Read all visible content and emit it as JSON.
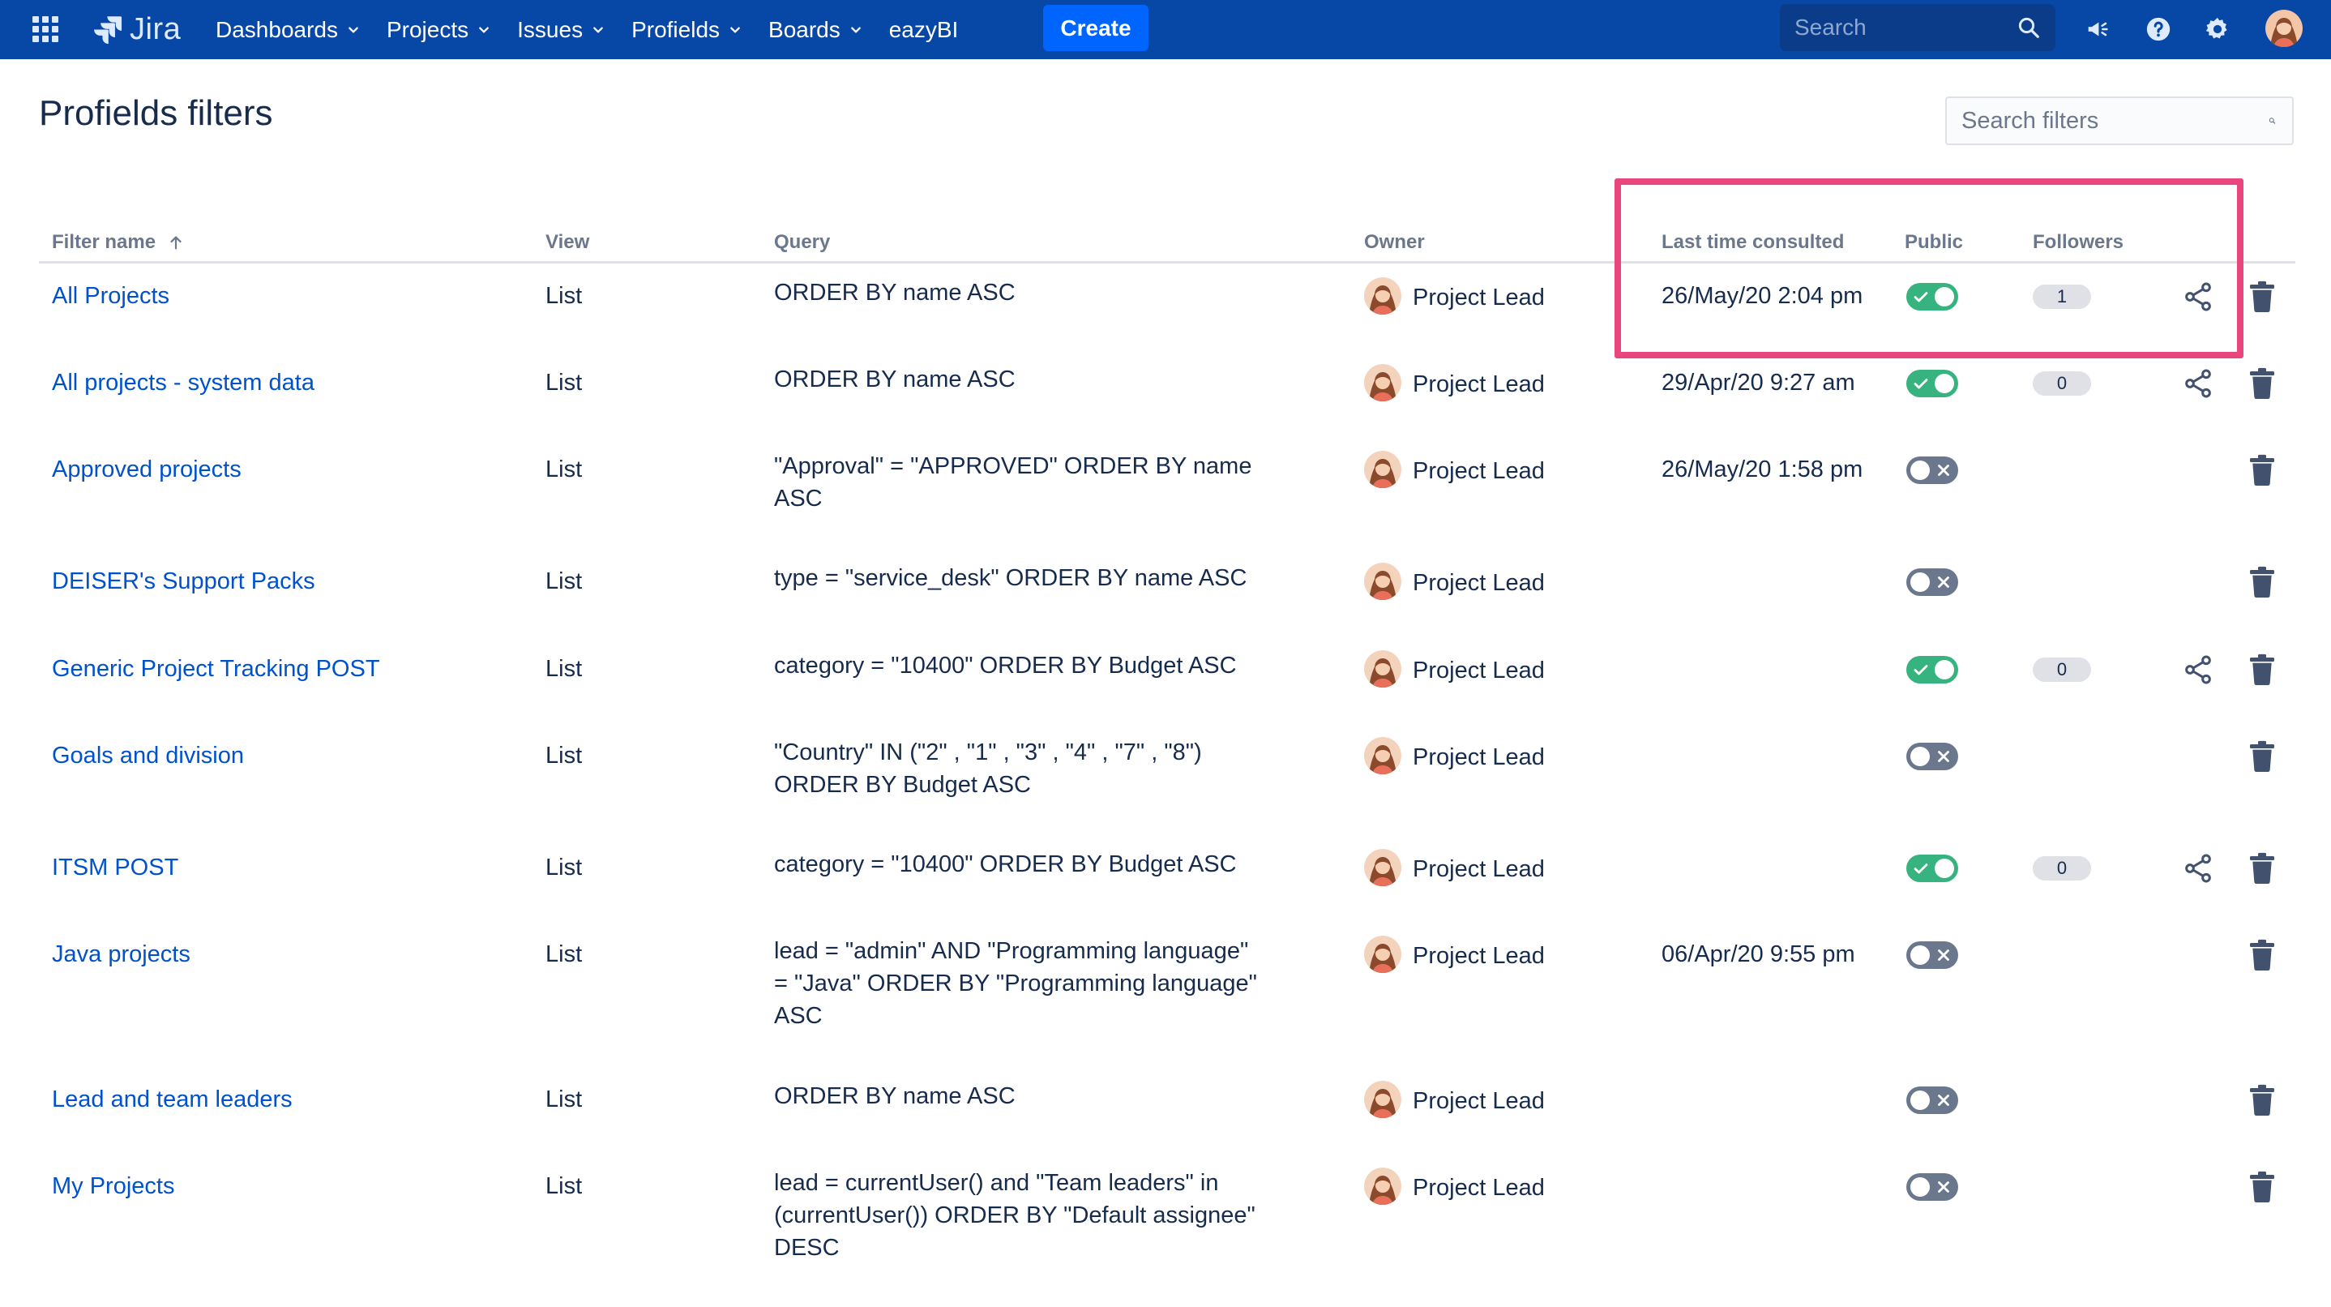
{
  "nav": {
    "logo_text": "Jira",
    "items": [
      {
        "label": "Dashboards",
        "dropdown": true
      },
      {
        "label": "Projects",
        "dropdown": true
      },
      {
        "label": "Issues",
        "dropdown": true
      },
      {
        "label": "Profields",
        "dropdown": true
      },
      {
        "label": "Boards",
        "dropdown": true
      },
      {
        "label": "eazyBI",
        "dropdown": false
      }
    ],
    "create_label": "Create",
    "search_placeholder": "Search",
    "icons": [
      "megaphone-icon",
      "help-icon",
      "settings-icon",
      "user-avatar"
    ],
    "colors": {
      "bar": "#0747a6",
      "create": "#0065ff"
    }
  },
  "page": {
    "title": "Profields filters",
    "search_placeholder": "Search filters"
  },
  "table": {
    "columns": {
      "filter_name": "Filter name",
      "view": "View",
      "query": "Query",
      "owner": "Owner",
      "last_consulted": "Last time consulted",
      "public": "Public",
      "followers": "Followers"
    },
    "sort": {
      "column": "filter_name",
      "direction": "ascending"
    },
    "rows": [
      {
        "name": "All Projects",
        "view": "List",
        "query": [
          "ORDER BY name ASC"
        ],
        "owner": "Project Lead",
        "last": "26/May/20 2:04 pm",
        "public": true,
        "followers": "1",
        "share": true
      },
      {
        "name": "All projects - system data",
        "view": "List",
        "query": [
          "ORDER BY name ASC"
        ],
        "owner": "Project Lead",
        "last": "29/Apr/20 9:27 am",
        "public": true,
        "followers": "0",
        "share": true
      },
      {
        "name": "Approved projects",
        "view": "List",
        "query": [
          "\"Approval\" = \"APPROVED\" ORDER BY name",
          "ASC"
        ],
        "owner": "Project Lead",
        "last": "26/May/20 1:58 pm",
        "public": false,
        "followers": null,
        "share": false
      },
      {
        "name": "DEISER's Support Packs",
        "view": "List",
        "query": [
          "type = \"service_desk\" ORDER BY name ASC"
        ],
        "owner": "Project Lead",
        "last": "",
        "public": false,
        "followers": null,
        "share": false
      },
      {
        "name": "Generic Project Tracking POST",
        "view": "List",
        "query": [
          "category = \"10400\" ORDER BY Budget ASC"
        ],
        "owner": "Project Lead",
        "last": "",
        "public": true,
        "followers": "0",
        "share": true
      },
      {
        "name": "Goals and division",
        "view": "List",
        "query": [
          "\"Country\" IN (\"2\" , \"1\" , \"3\" , \"4\" , \"7\" , \"8\")",
          "ORDER BY Budget ASC"
        ],
        "owner": "Project Lead",
        "last": "",
        "public": false,
        "followers": null,
        "share": false
      },
      {
        "name": "ITSM POST",
        "view": "List",
        "query": [
          "category = \"10400\" ORDER BY Budget ASC"
        ],
        "owner": "Project Lead",
        "last": "",
        "public": true,
        "followers": "0",
        "share": true
      },
      {
        "name": "Java projects",
        "view": "List",
        "query": [
          "lead = \"admin\" AND \"Programming language\"",
          "= \"Java\" ORDER BY \"Programming language\"",
          "ASC"
        ],
        "owner": "Project Lead",
        "last": "06/Apr/20 9:55 pm",
        "public": false,
        "followers": null,
        "share": false
      },
      {
        "name": "Lead and team leaders",
        "view": "List",
        "query": [
          "ORDER BY name ASC"
        ],
        "owner": "Project Lead",
        "last": "",
        "public": false,
        "followers": null,
        "share": false
      },
      {
        "name": "My Projects",
        "view": "List",
        "query": [
          "lead = currentUser() and \"Team leaders\" in",
          "(currentUser()) ORDER BY \"Default assignee\"",
          "DESC"
        ],
        "owner": "Project Lead",
        "last": "",
        "public": false,
        "followers": null,
        "share": false
      }
    ]
  },
  "accent": {
    "link": "#0052cc",
    "toggle_on": "#36b37e",
    "toggle_off": "#6b778c",
    "highlight": "#e8467c"
  }
}
